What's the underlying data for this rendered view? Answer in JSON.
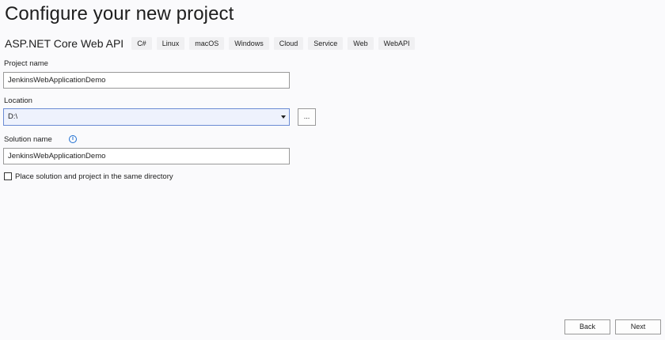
{
  "title": "Configure your new project",
  "template": {
    "name": "ASP.NET Core Web API",
    "tags": [
      "C#",
      "Linux",
      "macOS",
      "Windows",
      "Cloud",
      "Service",
      "Web",
      "WebAPI"
    ]
  },
  "project_name": {
    "label": "Project name",
    "value": "JenkinsWebApplicationDemo"
  },
  "location": {
    "label": "Location",
    "value": "D:\\",
    "browse_label": "..."
  },
  "solution_name": {
    "label": "Solution name",
    "info_icon": "i",
    "value": "JenkinsWebApplicationDemo"
  },
  "same_directory": {
    "label": "Place solution and project in the same directory",
    "checked": false
  },
  "footer": {
    "back_label": "Back",
    "next_label": "Next"
  }
}
